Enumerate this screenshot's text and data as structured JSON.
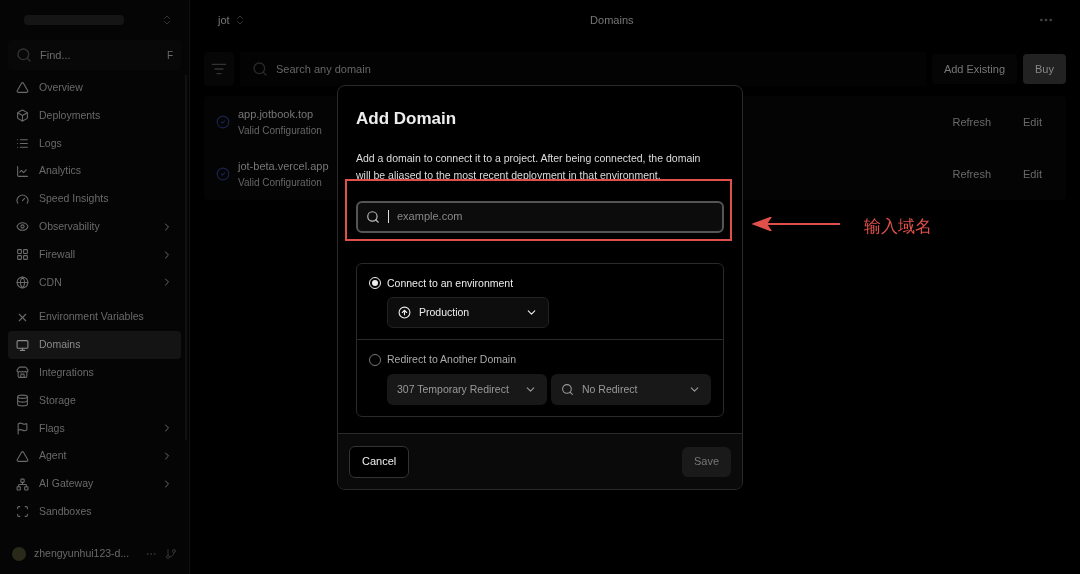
{
  "sidebar": {
    "search": {
      "placeholder": "Find...",
      "shortcut": "F"
    },
    "groups": [
      [
        {
          "label": "Overview",
          "chevron": false,
          "selected": false
        },
        {
          "label": "Deployments",
          "chevron": false,
          "selected": false
        },
        {
          "label": "Logs",
          "chevron": false,
          "selected": false
        },
        {
          "label": "Analytics",
          "chevron": false,
          "selected": false
        },
        {
          "label": "Speed Insights",
          "chevron": false,
          "selected": false
        },
        {
          "label": "Observability",
          "chevron": true,
          "selected": false
        },
        {
          "label": "Firewall",
          "chevron": true,
          "selected": false
        },
        {
          "label": "CDN",
          "chevron": true,
          "selected": false
        }
      ],
      [
        {
          "label": "Environment Variables",
          "chevron": false,
          "selected": false
        },
        {
          "label": "Domains",
          "chevron": false,
          "selected": true
        },
        {
          "label": "Integrations",
          "chevron": false,
          "selected": false
        },
        {
          "label": "Storage",
          "chevron": false,
          "selected": false
        },
        {
          "label": "Flags",
          "chevron": true,
          "selected": false
        },
        {
          "label": "Agent",
          "chevron": true,
          "selected": false
        },
        {
          "label": "AI Gateway",
          "chevron": true,
          "selected": false
        },
        {
          "label": "Sandboxes",
          "chevron": false,
          "selected": false
        }
      ]
    ],
    "user": {
      "name": "zhengyunhui123-d..."
    }
  },
  "header": {
    "project": "jot",
    "title": "Domains"
  },
  "toolbar": {
    "search_placeholder": "Search any domain",
    "buttons": [
      "Add Existing",
      "Buy"
    ]
  },
  "domains": [
    {
      "name": "app.jotbook.top",
      "status": "Valid Configuration",
      "actions": [
        "Refresh",
        "Edit"
      ]
    },
    {
      "name": "jot-beta.vercel.app",
      "status": "Valid Configuration",
      "actions": [
        "Refresh",
        "Edit"
      ]
    }
  ],
  "dialog": {
    "title": "Add Domain",
    "description": "Add a domain to connect it to a project. After being connected, the domain will be aliased to the most recent deployment in that environment.",
    "input_placeholder": "example.com",
    "options": [
      {
        "label": "Connect to an environment",
        "selected": true,
        "selects": [
          {
            "kind": "environment",
            "value": "Production"
          }
        ]
      },
      {
        "label": "Redirect to Another Domain",
        "selected": false,
        "selects": [
          {
            "kind": "plain",
            "value": "307 Temporary Redirect"
          },
          {
            "kind": "search",
            "value": "No Redirect"
          }
        ]
      }
    ],
    "cancel": "Cancel",
    "save": {
      "label": "Save",
      "disabled": true
    }
  },
  "annotation": {
    "text": "输入域名"
  }
}
